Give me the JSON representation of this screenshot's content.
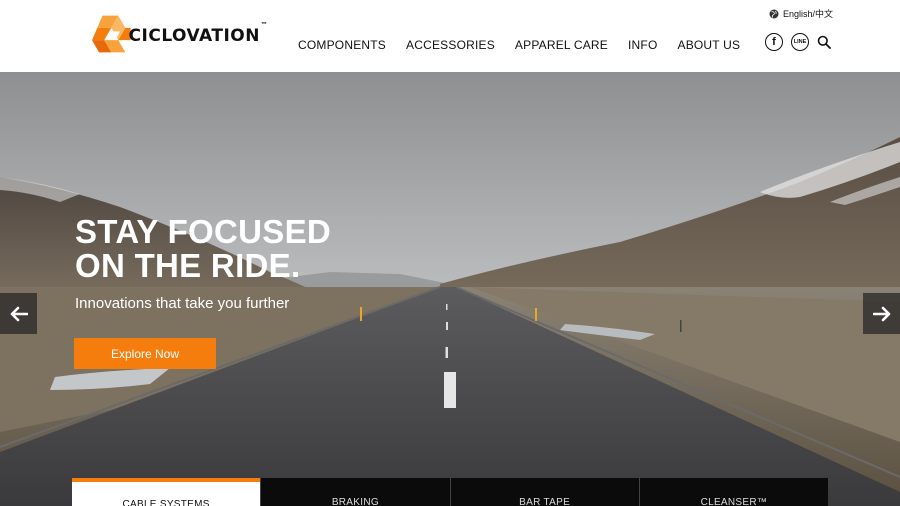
{
  "brand": {
    "name": "CICLOVATION",
    "tm": "™",
    "accent_color": "#f47d0e"
  },
  "nav": {
    "items": [
      {
        "label": "COMPONENTS"
      },
      {
        "label": "ACCESSORIES"
      },
      {
        "label": "APPAREL CARE"
      },
      {
        "label": "INFO"
      },
      {
        "label": "ABOUT US"
      }
    ]
  },
  "language": {
    "icon": "globe-icon",
    "label": "English/中文"
  },
  "social": {
    "facebook_icon": "f",
    "line_icon": "LINE",
    "search_icon": "search-icon"
  },
  "hero": {
    "title_line1": "STAY FOCUSED",
    "title_line2": "ON THE RIDE.",
    "subtitle": "Innovations that take you further",
    "cta_label": "Explore Now",
    "prev_icon": "arrow-left-icon",
    "next_icon": "arrow-right-icon"
  },
  "tabs": [
    {
      "label": "CABLE SYSTEMS",
      "active": true
    },
    {
      "label": "BRAKING",
      "active": false
    },
    {
      "label": "BAR TAPE",
      "active": false
    },
    {
      "label": "CLEANSER™",
      "active": false
    }
  ]
}
